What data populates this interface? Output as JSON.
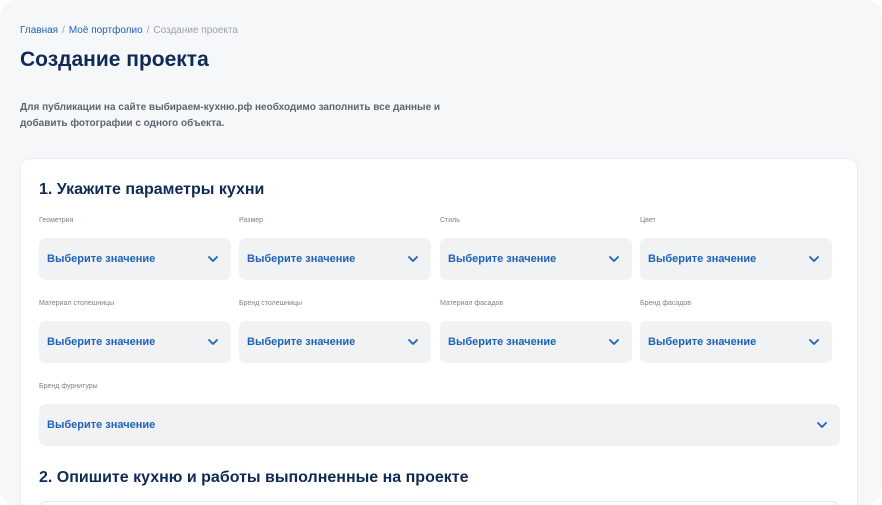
{
  "breadcrumbs": [
    {
      "label": "Главная",
      "link": true
    },
    {
      "label": "Моё портфолио",
      "link": true
    },
    {
      "label": "Создание проекта",
      "link": false
    }
  ],
  "breadcrumb_separator": "/",
  "page_title": "Создание проекта",
  "description": "Для публикации на сайте выбираем-кухню.рф необходимо заполнить все данные и добавить фотографии с одного объекта.",
  "section1": {
    "title": "1. Укажите параметры кухни",
    "fields": [
      {
        "label": "Геометрия",
        "value": "Выберите значение",
        "icon": "chevron-down-icon"
      },
      {
        "label": "Размер",
        "value": "Выберите значение",
        "icon": "chevron-down-icon"
      },
      {
        "label": "Стиль",
        "value": "Выберите значение",
        "icon": "chevron-down-icon"
      },
      {
        "label": "Цвет",
        "value": "Выберите значение",
        "icon": "chevron-down-icon"
      },
      {
        "label": "Материал столешницы",
        "value": "Выберите значение",
        "icon": "chevron-down-icon"
      },
      {
        "label": "Бренд столешницы",
        "value": "Выберите значение",
        "icon": "chevron-down-icon"
      },
      {
        "label": "Материал фасадов",
        "value": "Выберите значение",
        "icon": "chevron-down-icon"
      },
      {
        "label": "Бренд фасадов",
        "value": "Выберите значение",
        "icon": "chevron-down-icon"
      },
      {
        "label": "Бренд фурнитуры",
        "value": "Выберите значение",
        "icon": "chevron-down-icon"
      }
    ]
  },
  "section2": {
    "title": "2. Опишите кухню и работы выполненные на проекте"
  },
  "colors": {
    "accent": "#1f62b8",
    "heading": "#0f2a54",
    "field_bg": "#f1f2f4",
    "page_bg": "#f6f7f9"
  }
}
